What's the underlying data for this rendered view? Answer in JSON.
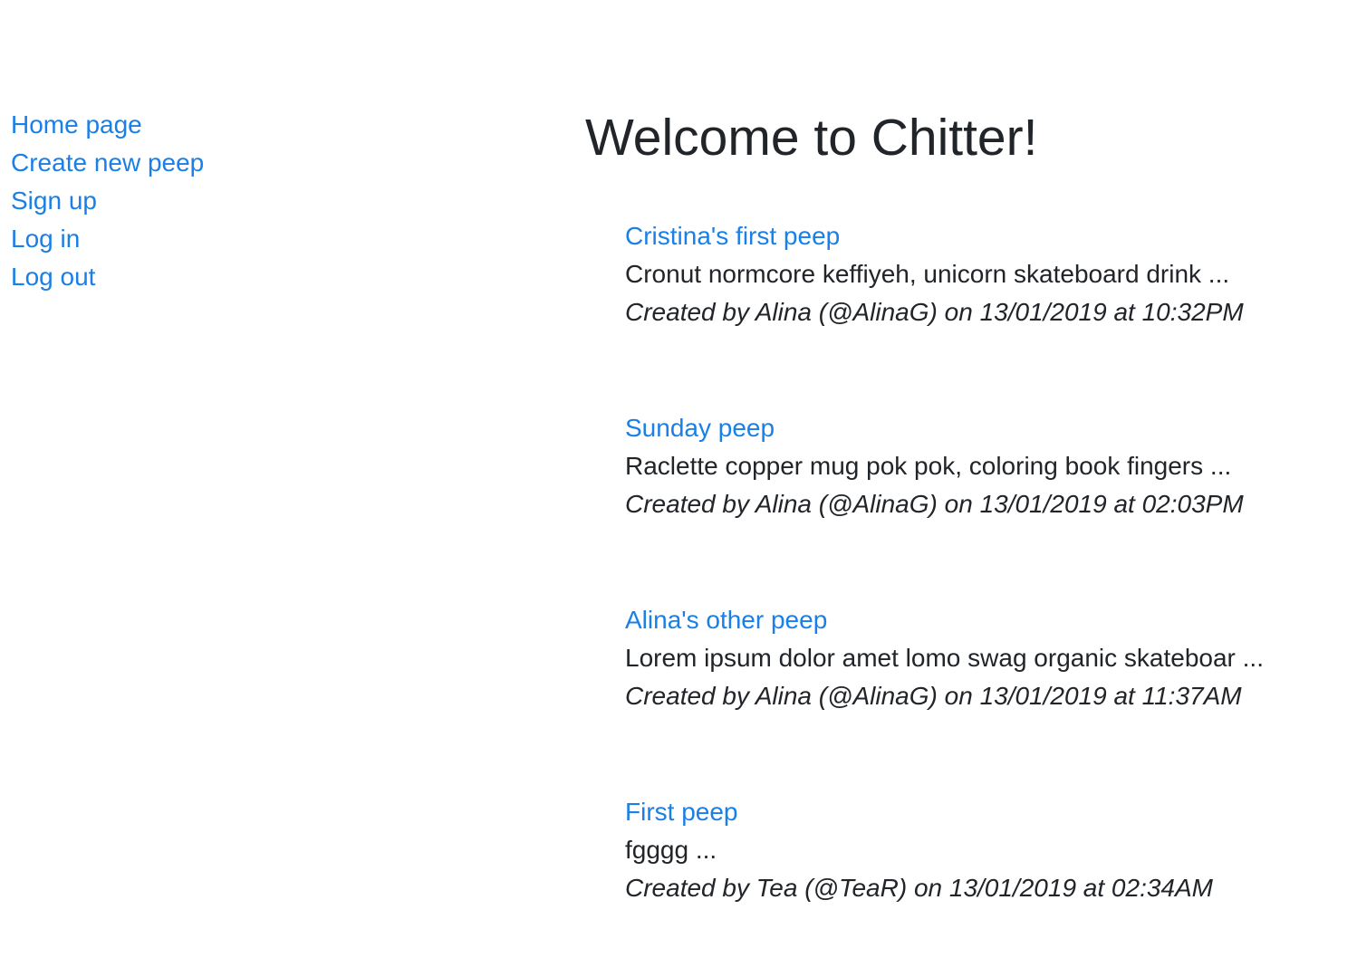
{
  "nav": {
    "items": [
      {
        "label": "Home page"
      },
      {
        "label": "Create new peep"
      },
      {
        "label": "Sign up"
      },
      {
        "label": "Log in"
      },
      {
        "label": "Log out"
      }
    ]
  },
  "main": {
    "title": "Welcome to Chitter!",
    "peeps": [
      {
        "title": "Cristina's first peep",
        "body": "Cronut normcore keffiyeh, unicorn skateboard drink ...",
        "meta": "Created by Alina (@AlinaG) on 13/01/2019 at 10:32PM"
      },
      {
        "title": "Sunday peep",
        "body": "Raclette copper mug pok pok, coloring book fingers ...",
        "meta": "Created by Alina (@AlinaG) on 13/01/2019 at 02:03PM"
      },
      {
        "title": "Alina's other peep",
        "body": "Lorem ipsum dolor amet lomo swag organic skateboar ...",
        "meta": "Created by Alina (@AlinaG) on 13/01/2019 at 11:37AM"
      },
      {
        "title": "First peep",
        "body": "fgggg ...",
        "meta": "Created by Tea (@TeaR) on 13/01/2019 at 02:34AM"
      }
    ]
  },
  "colors": {
    "link": "#1a7fe6",
    "text": "#212529",
    "background": "#ffffff"
  }
}
